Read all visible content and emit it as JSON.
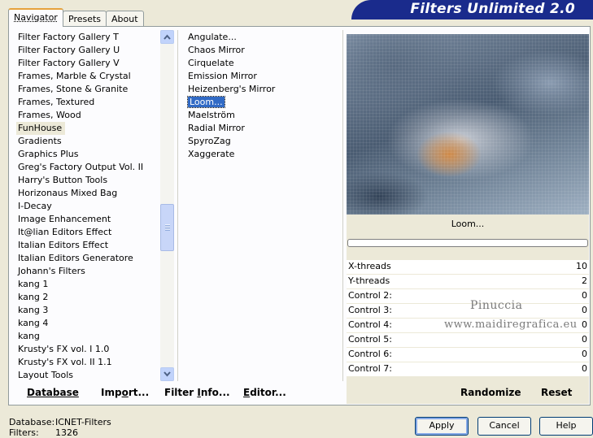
{
  "tabs": [
    {
      "label": "Navigator",
      "active": true
    },
    {
      "label": "Presets",
      "active": false
    },
    {
      "label": "About",
      "active": false
    }
  ],
  "app_title": "Filters Unlimited 2.0",
  "categories": [
    "Filter Factory Gallery T",
    "Filter Factory Gallery U",
    "Filter Factory Gallery V",
    "Frames, Marble & Crystal",
    "Frames, Stone & Granite",
    "Frames, Textured",
    "Frames, Wood",
    "FunHouse",
    "Gradients",
    "Graphics Plus",
    "Greg's Factory Output Vol. II",
    "Harry's Button Tools",
    "Horizonaus Mixed Bag",
    "I-Decay",
    "Image Enhancement",
    "It@lian Editors Effect",
    "Italian Editors Effect",
    "Italian Editors Generatore",
    "Johann's Filters",
    "kang 1",
    "kang 2",
    "kang 3",
    "kang 4",
    "kang",
    "Krusty's FX vol. I 1.0",
    "Krusty's FX vol. II 1.1",
    "Layout Tools"
  ],
  "selected_category": "FunHouse",
  "filters": [
    "Angulate...",
    "Chaos Mirror",
    "Cirquelate",
    "Emission Mirror",
    "Heizenberg's Mirror",
    "Loom...",
    "Maelström",
    "Radial Mirror",
    "SpyroZag",
    "Xaggerate"
  ],
  "selected_filter": "Loom...",
  "preview_label": "Loom...",
  "controls": [
    {
      "label": "X-threads",
      "value": "10"
    },
    {
      "label": "Y-threads",
      "value": "2"
    },
    {
      "label": "Control 2:",
      "value": "0"
    },
    {
      "label": "Control 3:",
      "value": "0"
    },
    {
      "label": "Control 4:",
      "value": "0"
    },
    {
      "label": "Control 5:",
      "value": "0"
    },
    {
      "label": "Control 6:",
      "value": "0"
    },
    {
      "label": "Control 7:",
      "value": "0"
    }
  ],
  "watermark": {
    "line1": "Pinuccia",
    "line2": "www.maidiregrafica.eu"
  },
  "panel_buttons": {
    "database": {
      "u": "D",
      "rest": "atabase"
    },
    "import": {
      "pre": "Imp",
      "u": "o",
      "rest": "rt..."
    },
    "filter_info": {
      "pre": "Filter ",
      "u": "I",
      "rest": "nfo..."
    },
    "editor": {
      "u": "E",
      "rest": "ditor..."
    },
    "randomize": "Randomize",
    "reset": "Reset"
  },
  "footer": {
    "database_label": "Database:",
    "database_value": "ICNET-Filters",
    "filters_label": "Filters:",
    "filters_value": "1326",
    "apply": "Apply",
    "cancel": "Cancel",
    "help": "Help"
  }
}
